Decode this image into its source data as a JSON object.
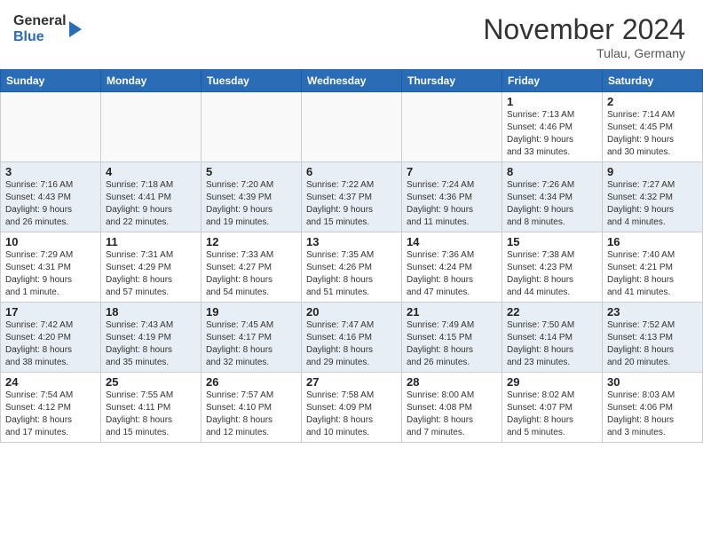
{
  "header": {
    "logo_general": "General",
    "logo_blue": "Blue",
    "month_title": "November 2024",
    "location": "Tulau, Germany"
  },
  "days_of_week": [
    "Sunday",
    "Monday",
    "Tuesday",
    "Wednesday",
    "Thursday",
    "Friday",
    "Saturday"
  ],
  "weeks": [
    [
      {
        "day": "",
        "info": ""
      },
      {
        "day": "",
        "info": ""
      },
      {
        "day": "",
        "info": ""
      },
      {
        "day": "",
        "info": ""
      },
      {
        "day": "",
        "info": ""
      },
      {
        "day": "1",
        "info": "Sunrise: 7:13 AM\nSunset: 4:46 PM\nDaylight: 9 hours\nand 33 minutes."
      },
      {
        "day": "2",
        "info": "Sunrise: 7:14 AM\nSunset: 4:45 PM\nDaylight: 9 hours\nand 30 minutes."
      }
    ],
    [
      {
        "day": "3",
        "info": "Sunrise: 7:16 AM\nSunset: 4:43 PM\nDaylight: 9 hours\nand 26 minutes."
      },
      {
        "day": "4",
        "info": "Sunrise: 7:18 AM\nSunset: 4:41 PM\nDaylight: 9 hours\nand 22 minutes."
      },
      {
        "day": "5",
        "info": "Sunrise: 7:20 AM\nSunset: 4:39 PM\nDaylight: 9 hours\nand 19 minutes."
      },
      {
        "day": "6",
        "info": "Sunrise: 7:22 AM\nSunset: 4:37 PM\nDaylight: 9 hours\nand 15 minutes."
      },
      {
        "day": "7",
        "info": "Sunrise: 7:24 AM\nSunset: 4:36 PM\nDaylight: 9 hours\nand 11 minutes."
      },
      {
        "day": "8",
        "info": "Sunrise: 7:26 AM\nSunset: 4:34 PM\nDaylight: 9 hours\nand 8 minutes."
      },
      {
        "day": "9",
        "info": "Sunrise: 7:27 AM\nSunset: 4:32 PM\nDaylight: 9 hours\nand 4 minutes."
      }
    ],
    [
      {
        "day": "10",
        "info": "Sunrise: 7:29 AM\nSunset: 4:31 PM\nDaylight: 9 hours\nand 1 minute."
      },
      {
        "day": "11",
        "info": "Sunrise: 7:31 AM\nSunset: 4:29 PM\nDaylight: 8 hours\nand 57 minutes."
      },
      {
        "day": "12",
        "info": "Sunrise: 7:33 AM\nSunset: 4:27 PM\nDaylight: 8 hours\nand 54 minutes."
      },
      {
        "day": "13",
        "info": "Sunrise: 7:35 AM\nSunset: 4:26 PM\nDaylight: 8 hours\nand 51 minutes."
      },
      {
        "day": "14",
        "info": "Sunrise: 7:36 AM\nSunset: 4:24 PM\nDaylight: 8 hours\nand 47 minutes."
      },
      {
        "day": "15",
        "info": "Sunrise: 7:38 AM\nSunset: 4:23 PM\nDaylight: 8 hours\nand 44 minutes."
      },
      {
        "day": "16",
        "info": "Sunrise: 7:40 AM\nSunset: 4:21 PM\nDaylight: 8 hours\nand 41 minutes."
      }
    ],
    [
      {
        "day": "17",
        "info": "Sunrise: 7:42 AM\nSunset: 4:20 PM\nDaylight: 8 hours\nand 38 minutes."
      },
      {
        "day": "18",
        "info": "Sunrise: 7:43 AM\nSunset: 4:19 PM\nDaylight: 8 hours\nand 35 minutes."
      },
      {
        "day": "19",
        "info": "Sunrise: 7:45 AM\nSunset: 4:17 PM\nDaylight: 8 hours\nand 32 minutes."
      },
      {
        "day": "20",
        "info": "Sunrise: 7:47 AM\nSunset: 4:16 PM\nDaylight: 8 hours\nand 29 minutes."
      },
      {
        "day": "21",
        "info": "Sunrise: 7:49 AM\nSunset: 4:15 PM\nDaylight: 8 hours\nand 26 minutes."
      },
      {
        "day": "22",
        "info": "Sunrise: 7:50 AM\nSunset: 4:14 PM\nDaylight: 8 hours\nand 23 minutes."
      },
      {
        "day": "23",
        "info": "Sunrise: 7:52 AM\nSunset: 4:13 PM\nDaylight: 8 hours\nand 20 minutes."
      }
    ],
    [
      {
        "day": "24",
        "info": "Sunrise: 7:54 AM\nSunset: 4:12 PM\nDaylight: 8 hours\nand 17 minutes."
      },
      {
        "day": "25",
        "info": "Sunrise: 7:55 AM\nSunset: 4:11 PM\nDaylight: 8 hours\nand 15 minutes."
      },
      {
        "day": "26",
        "info": "Sunrise: 7:57 AM\nSunset: 4:10 PM\nDaylight: 8 hours\nand 12 minutes."
      },
      {
        "day": "27",
        "info": "Sunrise: 7:58 AM\nSunset: 4:09 PM\nDaylight: 8 hours\nand 10 minutes."
      },
      {
        "day": "28",
        "info": "Sunrise: 8:00 AM\nSunset: 4:08 PM\nDaylight: 8 hours\nand 7 minutes."
      },
      {
        "day": "29",
        "info": "Sunrise: 8:02 AM\nSunset: 4:07 PM\nDaylight: 8 hours\nand 5 minutes."
      },
      {
        "day": "30",
        "info": "Sunrise: 8:03 AM\nSunset: 4:06 PM\nDaylight: 8 hours\nand 3 minutes."
      }
    ]
  ]
}
